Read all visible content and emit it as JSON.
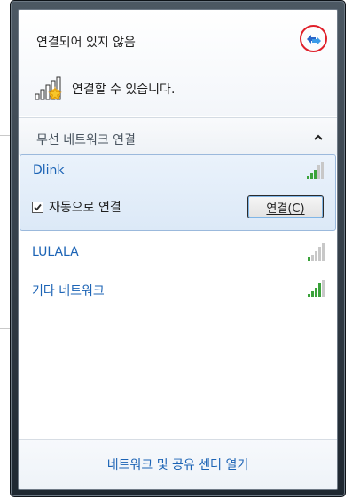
{
  "status": {
    "title": "연결되어 있지 않음",
    "connection_text": "연결할 수 있습니다."
  },
  "section": {
    "title": "무선 네트워크 연결"
  },
  "networks": [
    {
      "name": "Dlink",
      "expanded": true,
      "auto_connect_label": "자동으로 연결",
      "auto_connect_checked": true,
      "connect_label": "연결(C)"
    },
    {
      "name": "LULALA"
    },
    {
      "name": "기타 네트워크"
    }
  ],
  "footer": {
    "link": "네트워크 및 공유 센터 열기"
  },
  "icons": {
    "refresh": "refresh-arrows-icon",
    "signal": "wifi-signal-bars-icon",
    "collapse": "chevron-up-icon",
    "connection_status": "signal-bars-with-star-icon"
  },
  "colors": {
    "link_blue": "#1b63b5",
    "signal_green": "#3aa23a",
    "highlight_border": "#9bb9dc",
    "refresh_circle": "#e0202a"
  }
}
